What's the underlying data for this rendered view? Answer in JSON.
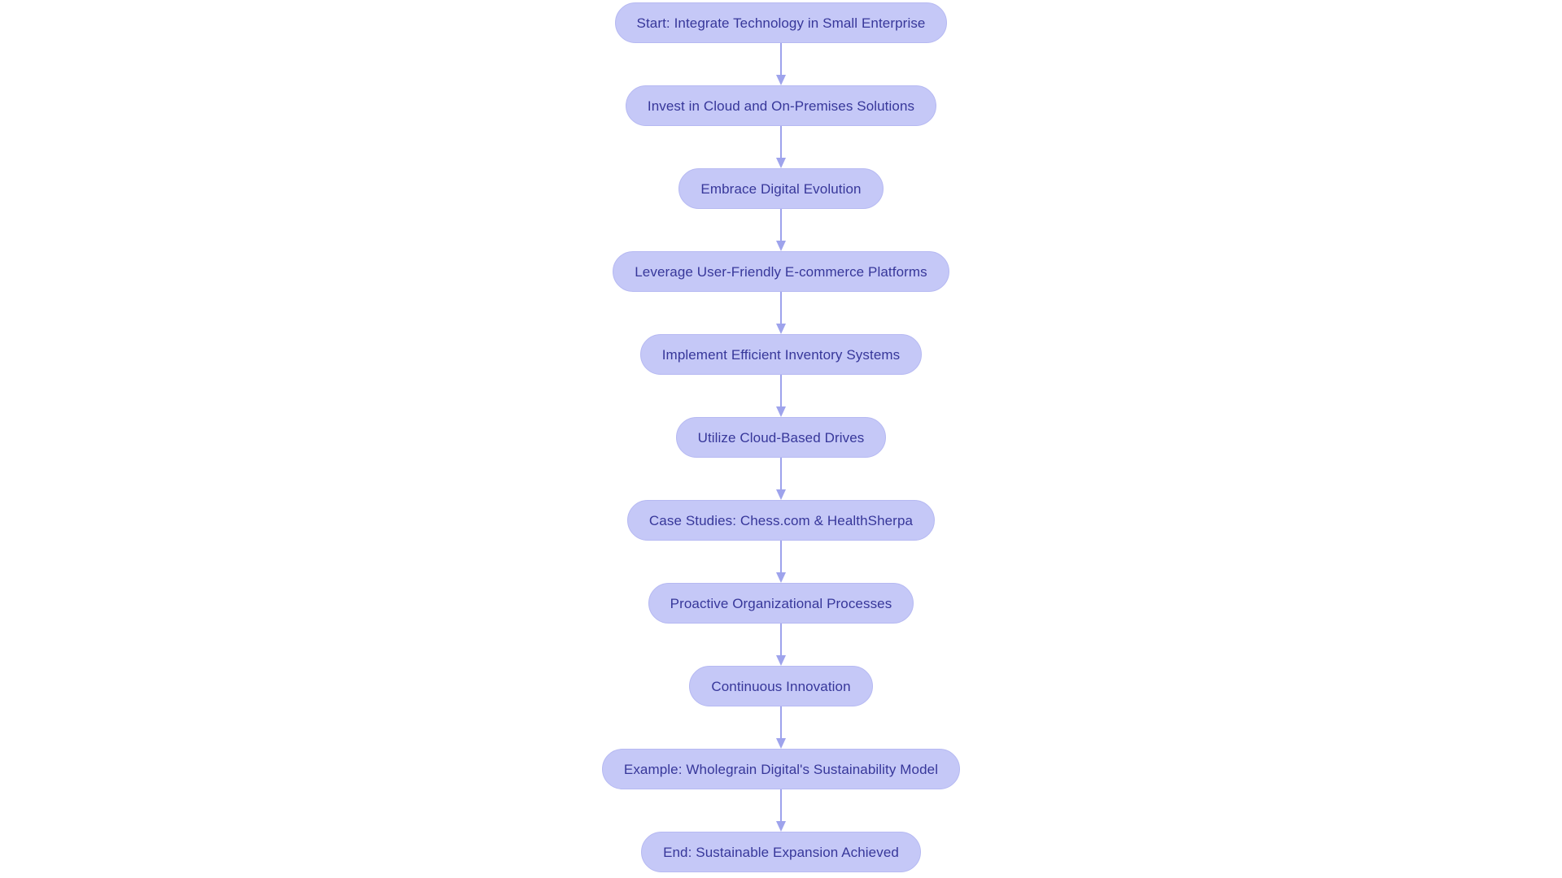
{
  "diagram": {
    "type": "flowchart",
    "orientation": "top-to-bottom",
    "background_color": "#ffffff",
    "node_fill_color": "#c5c8f7",
    "node_border_color": "#b6b9f2",
    "node_text_color": "#37379a",
    "connector_color": "#9ea3ec",
    "nodes": [
      {
        "id": "n1",
        "label": "Start: Integrate Technology in Small Enterprise"
      },
      {
        "id": "n2",
        "label": "Invest in Cloud and On-Premises Solutions"
      },
      {
        "id": "n3",
        "label": "Embrace Digital Evolution"
      },
      {
        "id": "n4",
        "label": "Leverage User-Friendly E-commerce Platforms"
      },
      {
        "id": "n5",
        "label": "Implement Efficient Inventory Systems"
      },
      {
        "id": "n6",
        "label": "Utilize Cloud-Based Drives"
      },
      {
        "id": "n7",
        "label": "Case Studies: Chess.com & HealthSherpa"
      },
      {
        "id": "n8",
        "label": "Proactive Organizational Processes"
      },
      {
        "id": "n9",
        "label": "Continuous Innovation"
      },
      {
        "id": "n10",
        "label": "Example: Wholegrain Digital's Sustainability Model"
      },
      {
        "id": "n11",
        "label": "End: Sustainable Expansion Achieved"
      }
    ],
    "edges": [
      {
        "from": "n1",
        "to": "n2",
        "label": ""
      },
      {
        "from": "n2",
        "to": "n3",
        "label": ""
      },
      {
        "from": "n3",
        "to": "n4",
        "label": ""
      },
      {
        "from": "n4",
        "to": "n5",
        "label": ""
      },
      {
        "from": "n5",
        "to": "n6",
        "label": ""
      },
      {
        "from": "n6",
        "to": "n7",
        "label": ""
      },
      {
        "from": "n7",
        "to": "n8",
        "label": ""
      },
      {
        "from": "n8",
        "to": "n9",
        "label": ""
      },
      {
        "from": "n9",
        "to": "n10",
        "label": ""
      },
      {
        "from": "n10",
        "to": "n11",
        "label": ""
      }
    ]
  }
}
